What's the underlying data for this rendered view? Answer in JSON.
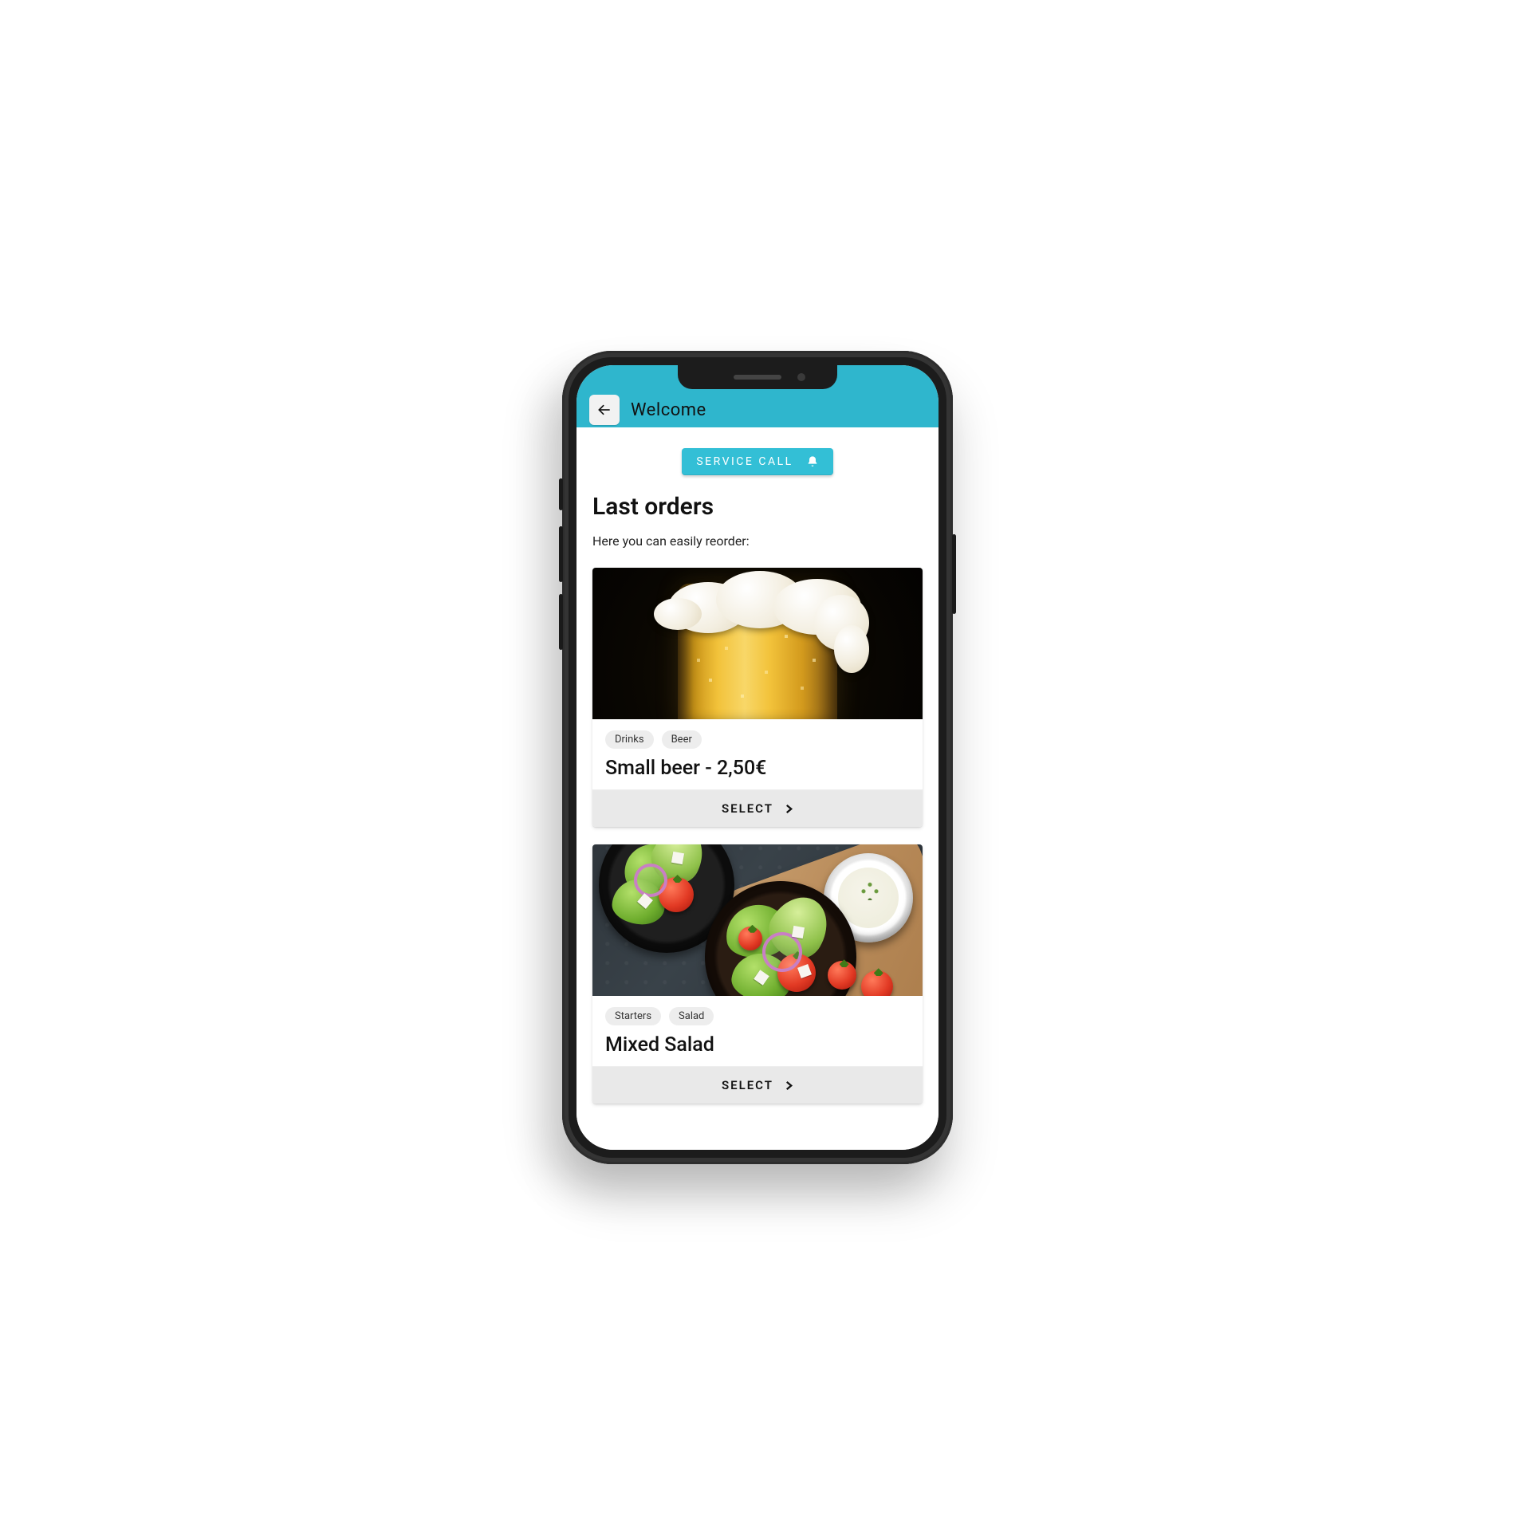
{
  "header": {
    "title": "Welcome"
  },
  "service_call": {
    "label": "SERVICE CALL"
  },
  "section": {
    "heading": "Last orders",
    "subtext": "Here you can easily reorder:"
  },
  "cards": [
    {
      "tags": [
        "Drinks",
        "Beer"
      ],
      "title": "Small beer - 2,50€",
      "action": "SELECT"
    },
    {
      "tags": [
        "Starters",
        "Salad"
      ],
      "title": "Mixed Salad",
      "action": "SELECT"
    }
  ]
}
